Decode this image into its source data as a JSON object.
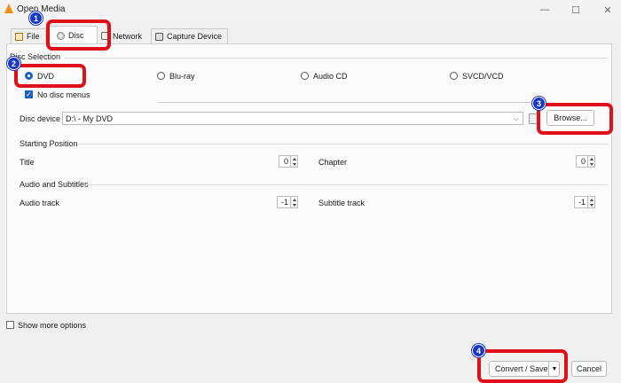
{
  "window": {
    "title": "Open Media",
    "minimize": "—",
    "maximize": "☐",
    "close": "✕"
  },
  "tabs": [
    {
      "label": "File"
    },
    {
      "label": "Disc"
    },
    {
      "label": "Network"
    },
    {
      "label": "Capture Device"
    }
  ],
  "disc_selection": {
    "label": "Disc Selection",
    "options": [
      "DVD",
      "Blu-ray",
      "Audio CD",
      "SVCD/VCD"
    ],
    "selected": "DVD",
    "no_disc_menus": "No disc menus",
    "device_label": "Disc device",
    "device_value": "D:\\ - My DVD",
    "browse": "Browse..."
  },
  "starting_position": {
    "label": "Starting Position",
    "title_label": "Title",
    "title_value": "0",
    "chapter_label": "Chapter",
    "chapter_value": "0"
  },
  "audio_subtitles": {
    "label": "Audio and Subtitles",
    "audio_label": "Audio track",
    "audio_value": "-1",
    "subtitle_label": "Subtitle track",
    "subtitle_value": "-1"
  },
  "footer": {
    "show_more": "Show more options",
    "convert_save": "Convert / Save",
    "cancel": "Cancel"
  },
  "annotations": [
    "1",
    "2",
    "3",
    "4"
  ],
  "colors": {
    "highlight": "#e0101a",
    "badge": "#1a38c8",
    "accent": "#1f5fbf"
  }
}
